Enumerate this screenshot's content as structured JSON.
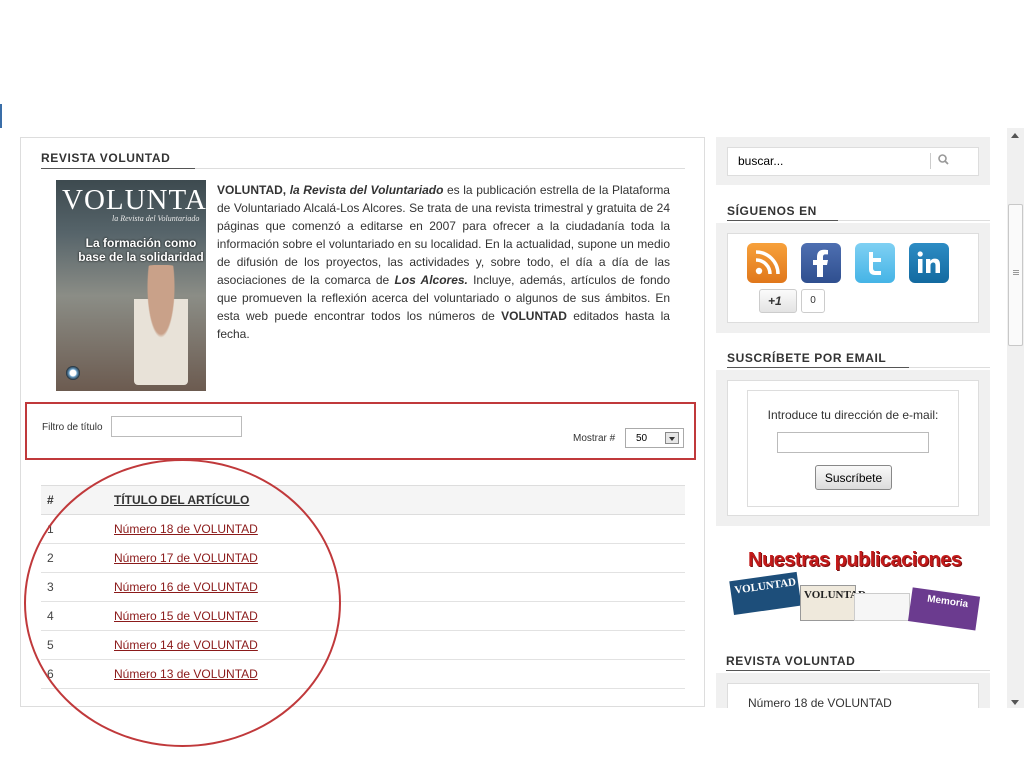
{
  "main": {
    "heading": "REVISTA VOLUNTAD",
    "cover": {
      "title": "VOLUNTAD",
      "subtitle": "la Revista del Voluntariado",
      "headline": "La formación como base de la solidaridad"
    },
    "intro": {
      "brand": "VOLUNTAD,",
      "tagline": "la Revista del Voluntariado",
      "part1": " es la publicación estrella de la Plataforma de Voluntariado Alcalá-Los Alcores. Se trata de una revista trimestral y gratuita de 24 páginas que comenzó a editarse en 2007 para ofrecer a la ciudadanía toda la información sobre el voluntariado en su localidad. En la actualidad, supone un medio de difusión  de los proyectos, las actividades y, sobre todo, el día a día de las asociaciones de la comarca de ",
      "region": "Los Alcores.",
      "part2": " Incluye, además, artículos de fondo que promueven la reflexión acerca del voluntariado o algunos de sus ámbitos. En esta web puede encontrar todos los números de ",
      "brand2": "VOLUNTAD",
      "part3": " editados hasta la fecha."
    },
    "filter": {
      "label": "Filtro de título",
      "value": "",
      "show_label": "Mostrar #",
      "show_value": "50"
    },
    "table": {
      "col_num": "#",
      "col_title": "TÍTULO DEL ARTÍCULO",
      "rows": [
        {
          "num": "1",
          "title": "Número 18 de VOLUNTAD"
        },
        {
          "num": "2",
          "title": "Número 17 de VOLUNTAD"
        },
        {
          "num": "3",
          "title": "Número 16 de VOLUNTAD"
        },
        {
          "num": "4",
          "title": "Número 15 de VOLUNTAD"
        },
        {
          "num": "5",
          "title": "Número 14 de VOLUNTAD"
        },
        {
          "num": "6",
          "title": "Número 13 de VOLUNTAD"
        }
      ]
    }
  },
  "sidebar": {
    "search": {
      "placeholder": "buscar..."
    },
    "follow": {
      "heading": "SÍGUENOS EN",
      "networks": [
        "rss-icon",
        "facebook-icon",
        "twitter-icon",
        "linkedin-icon"
      ],
      "gplus_label": "+1",
      "gplus_count": "0"
    },
    "subscribe": {
      "heading": "SUSCRÍBETE POR EMAIL",
      "label": "Introduce tu dirección de e-mail:",
      "button": "Suscríbete"
    },
    "publications": {
      "title": "Nuestras publicaciones",
      "mag1": "VOLUNTAD",
      "mag2": "VOLUNTAD",
      "mag3": "Memoria"
    },
    "latest": {
      "heading": "REVISTA VOLUNTAD",
      "item": "Número 18 de VOLUNTAD"
    }
  },
  "colors": {
    "annotation": "#c0393b",
    "link": "#8b1a1a"
  }
}
